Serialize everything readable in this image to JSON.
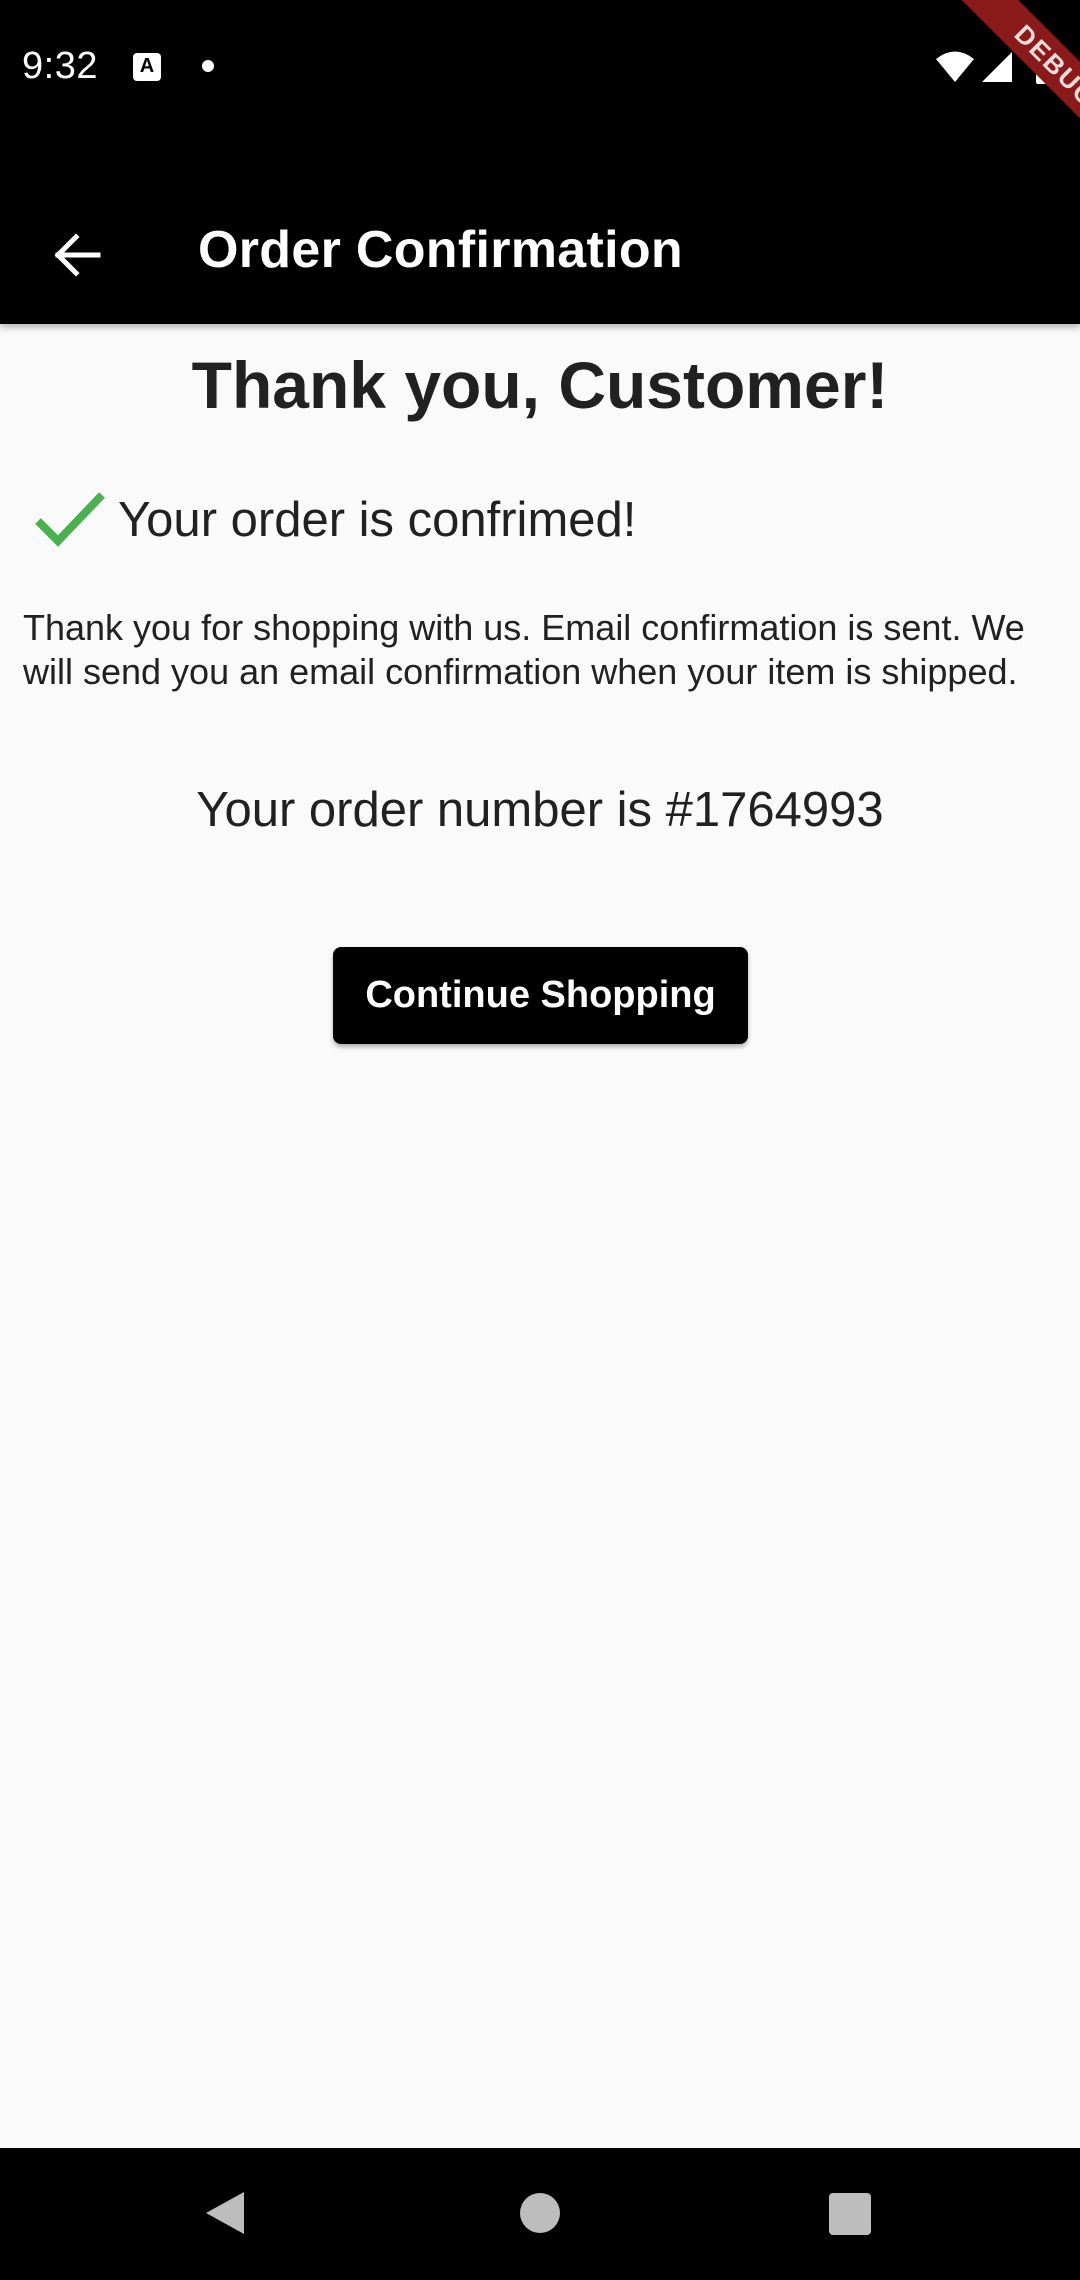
{
  "status_bar": {
    "time": "9:32",
    "icons": [
      "font-a-icon",
      "notification-dot-icon",
      "wifi-icon",
      "signal-icon",
      "battery-icon"
    ]
  },
  "debug_banner": {
    "label": "DEBUG"
  },
  "app_bar": {
    "back_icon": "arrow-back-icon",
    "title": "Order Confirmation"
  },
  "content": {
    "heading": "Thank you, Customer!",
    "confirmation": {
      "icon": "check-icon",
      "text": "Your order is confrimed!"
    },
    "thanks_message": "Thank you for shopping with us. Email confirmation is sent. We will send you an email confirmation when your item is shipped.",
    "order_number_text": "Your order number is #1764993",
    "continue_button_label": "Continue Shopping"
  },
  "nav_bar": {
    "icons": [
      "nav-back-icon",
      "nav-home-icon",
      "nav-recents-icon"
    ]
  },
  "colors": {
    "app_bar": "#000000",
    "background": "#fafafa",
    "check": "#4caf50",
    "button": "#000000",
    "text": "#212121"
  }
}
